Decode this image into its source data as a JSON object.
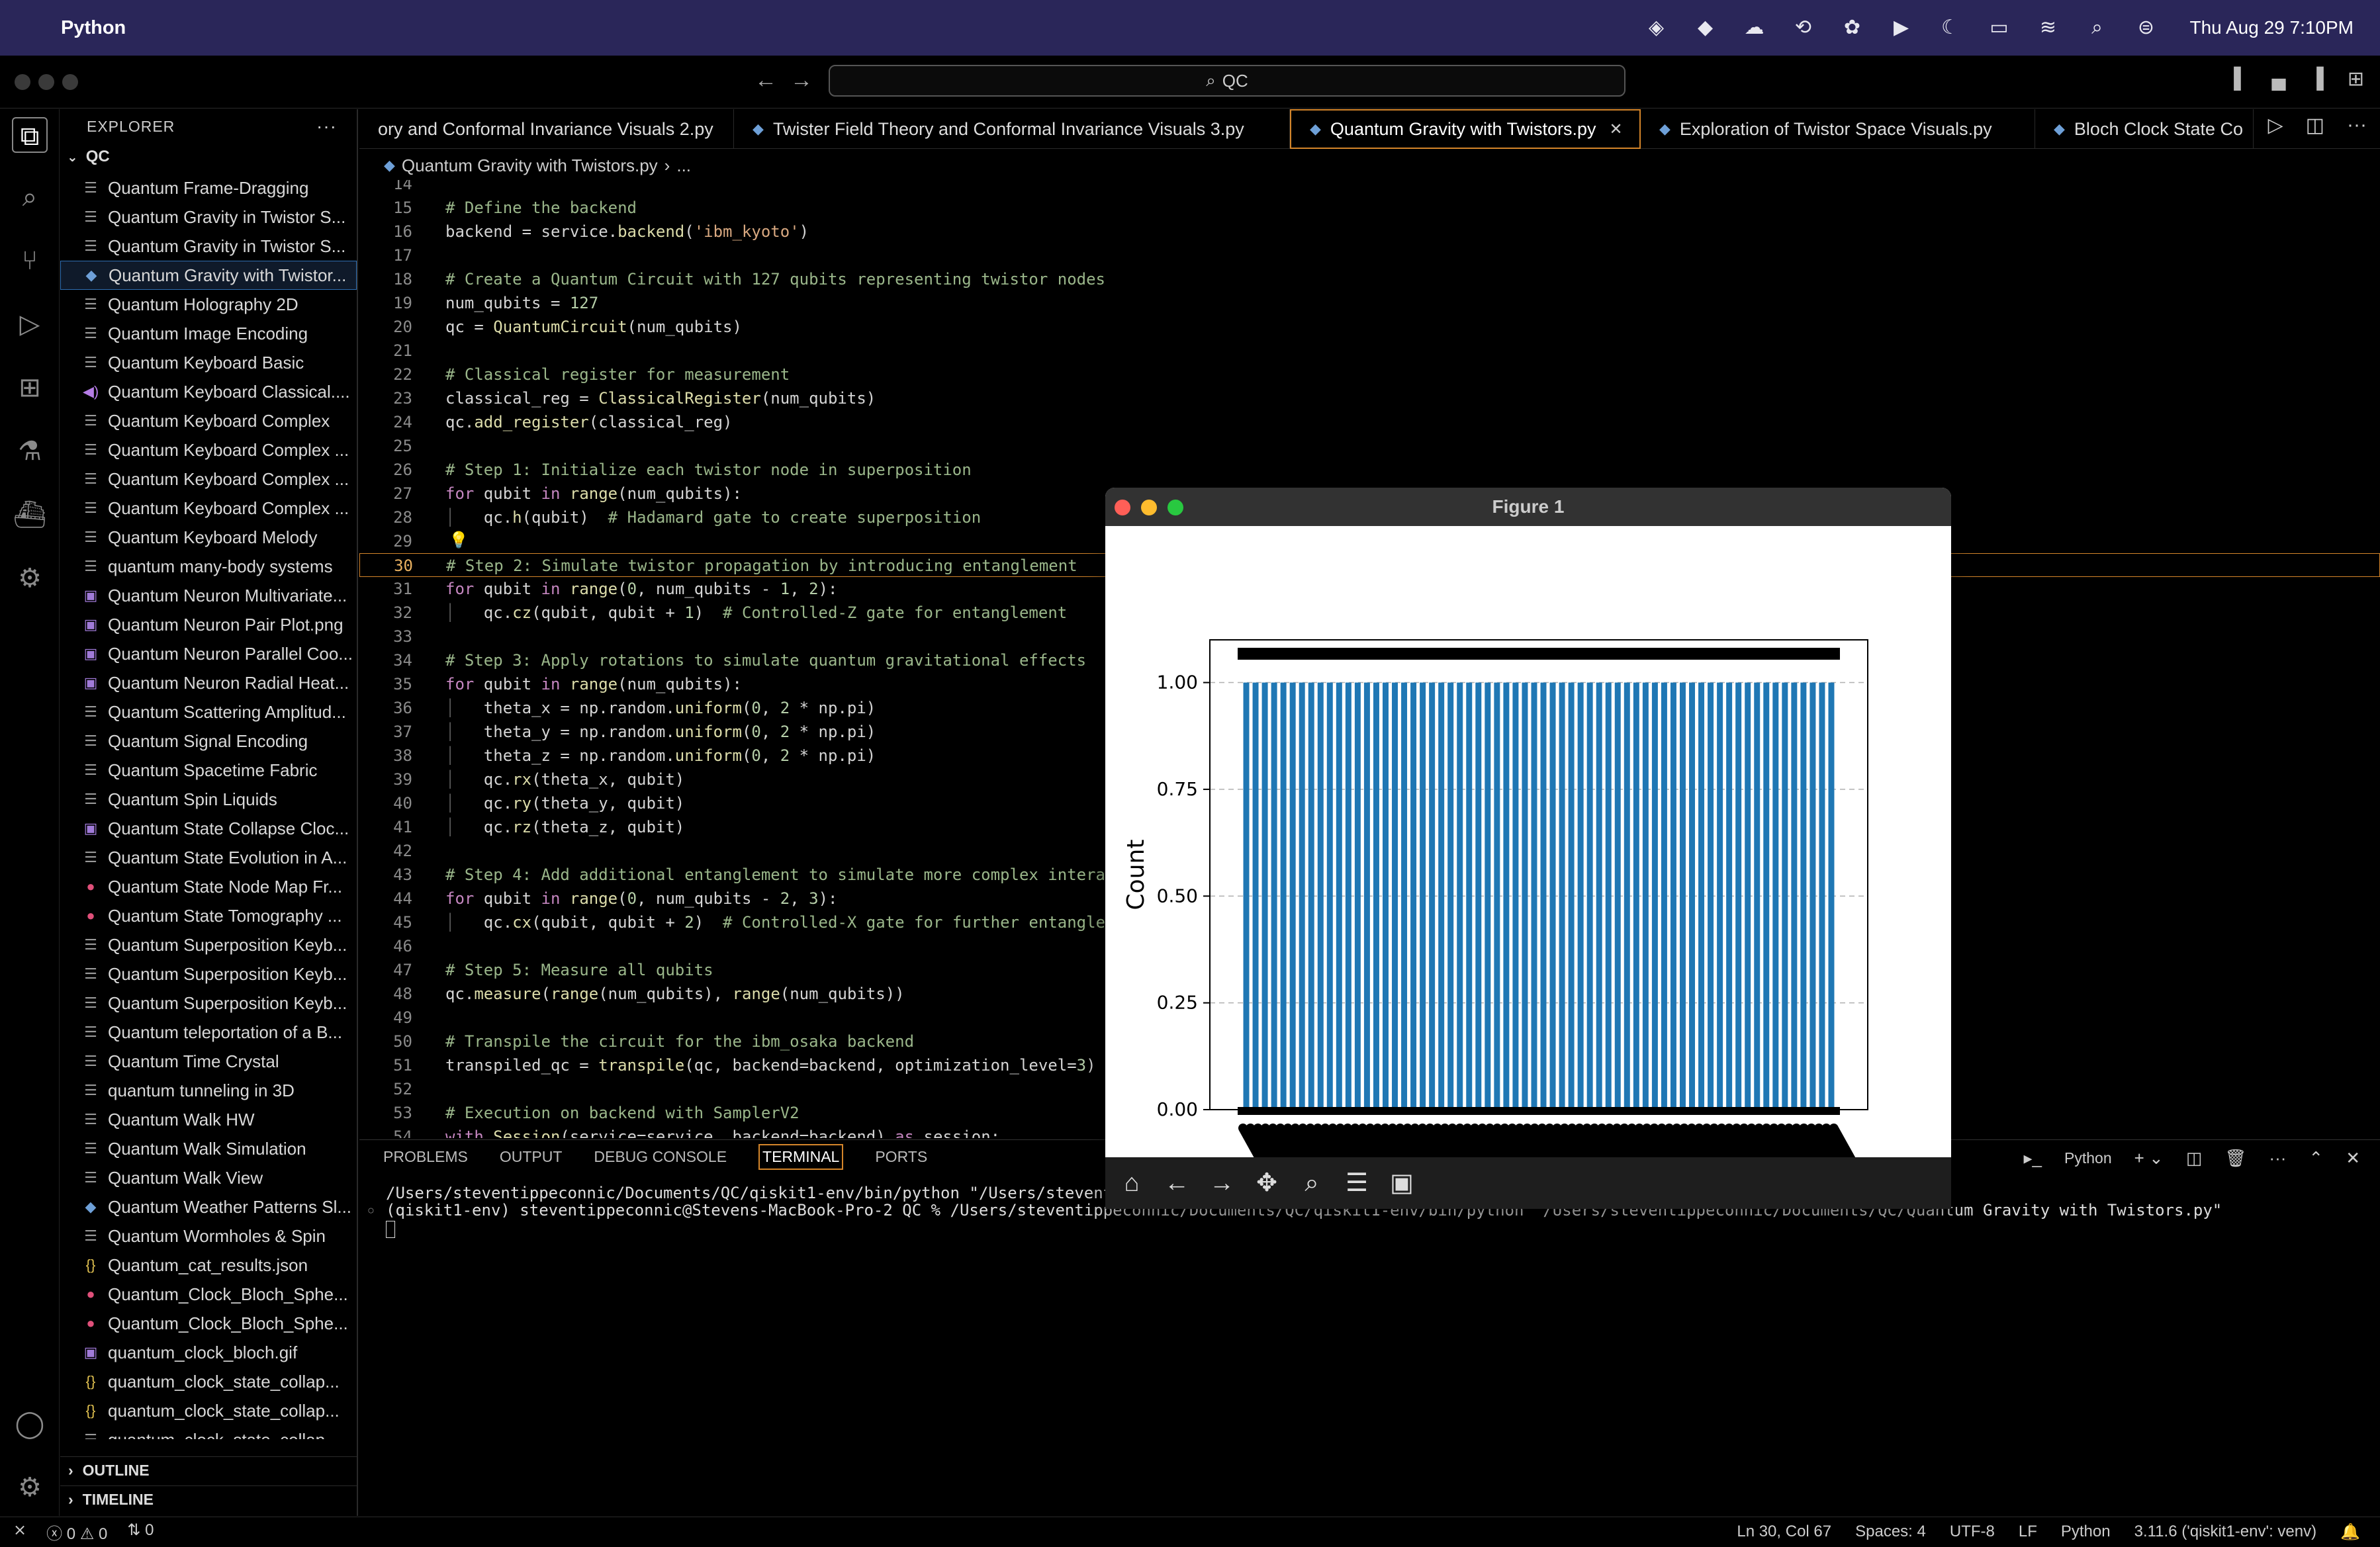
{
  "menubar": {
    "app_name": "Python",
    "clock": "Thu Aug 29  7:10PM",
    "icons": [
      "adguard-icon",
      "vpn-icon",
      "cloud-icon",
      "sync-icon",
      "chatgpt-icon",
      "play-icon",
      "moon-icon",
      "battery-icon",
      "wifi-icon",
      "search-icon",
      "control-center-icon"
    ]
  },
  "titlebar": {
    "search": "QC"
  },
  "sidebar": {
    "header": "EXPLORER",
    "folder": "QC",
    "files": [
      {
        "name": "Quantum Frame-Dragging",
        "type": "txt"
      },
      {
        "name": "Quantum Gravity in Twistor S...",
        "type": "txt"
      },
      {
        "name": "Quantum Gravity in Twistor S...",
        "type": "txt"
      },
      {
        "name": "Quantum Gravity with Twistor...",
        "type": "py",
        "selected": true
      },
      {
        "name": "Quantum Holography 2D",
        "type": "txt"
      },
      {
        "name": "Quantum Image Encoding",
        "type": "txt"
      },
      {
        "name": "Quantum Keyboard Basic",
        "type": "txt"
      },
      {
        "name": "Quantum Keyboard Classical....",
        "type": "audio"
      },
      {
        "name": "Quantum Keyboard Complex",
        "type": "txt"
      },
      {
        "name": "Quantum Keyboard Complex ...",
        "type": "txt"
      },
      {
        "name": "Quantum Keyboard Complex ...",
        "type": "txt"
      },
      {
        "name": "Quantum Keyboard Complex ...",
        "type": "txt"
      },
      {
        "name": "Quantum Keyboard Melody",
        "type": "txt"
      },
      {
        "name": "quantum many-body systems",
        "type": "txt"
      },
      {
        "name": "Quantum Neuron Multivariate...",
        "type": "img"
      },
      {
        "name": "Quantum Neuron Pair Plot.png",
        "type": "img"
      },
      {
        "name": "Quantum Neuron Parallel Coo...",
        "type": "img"
      },
      {
        "name": "Quantum Neuron Radial Heat...",
        "type": "img"
      },
      {
        "name": "Quantum Scattering Amplitud...",
        "type": "txt"
      },
      {
        "name": "Quantum Signal Encoding",
        "type": "txt"
      },
      {
        "name": "Quantum Spacetime Fabric",
        "type": "txt"
      },
      {
        "name": "Quantum Spin Liquids",
        "type": "txt"
      },
      {
        "name": "Quantum State Collapse Cloc...",
        "type": "img"
      },
      {
        "name": "Quantum State Evolution in A...",
        "type": "txt"
      },
      {
        "name": "Quantum State Node Map Fr...",
        "type": "red"
      },
      {
        "name": "Quantum State Tomography ...",
        "type": "red"
      },
      {
        "name": "Quantum Superposition Keyb...",
        "type": "txt"
      },
      {
        "name": "Quantum Superposition Keyb...",
        "type": "txt"
      },
      {
        "name": "Quantum Superposition Keyb...",
        "type": "txt"
      },
      {
        "name": "Quantum teleportation of a B...",
        "type": "txt"
      },
      {
        "name": "Quantum Time Crystal",
        "type": "txt"
      },
      {
        "name": "quantum tunneling in 3D",
        "type": "txt"
      },
      {
        "name": "Quantum Walk HW",
        "type": "txt"
      },
      {
        "name": "Quantum Walk Simulation",
        "type": "txt"
      },
      {
        "name": "Quantum Walk View",
        "type": "txt"
      },
      {
        "name": "Quantum Weather Patterns Sl...",
        "type": "py"
      },
      {
        "name": "Quantum Wormholes & Spin",
        "type": "txt"
      },
      {
        "name": "Quantum_cat_results.json",
        "type": "json"
      },
      {
        "name": "Quantum_Clock_Bloch_Sphe...",
        "type": "red"
      },
      {
        "name": "Quantum_Clock_Bloch_Sphe...",
        "type": "red"
      },
      {
        "name": "quantum_clock_bloch.gif",
        "type": "img"
      },
      {
        "name": "quantum_clock_state_collap...",
        "type": "json"
      },
      {
        "name": "quantum_clock_state_collap...",
        "type": "json"
      },
      {
        "name": "quantum_clock_state_collap...",
        "type": "txt"
      }
    ],
    "outline": "OUTLINE",
    "timeline": "TIMELINE"
  },
  "tabs": [
    {
      "label": "ory and Conformal Invariance Visuals 2.py",
      "active": false
    },
    {
      "label": "Twister Field Theory and Conformal Invariance Visuals 3.py",
      "active": false
    },
    {
      "label": "Quantum Gravity with Twistors.py",
      "active": true
    },
    {
      "label": "Exploration of Twistor Space Visuals.py",
      "active": false
    },
    {
      "label": "Bloch Clock State Co",
      "active": false
    }
  ],
  "breadcrumb": {
    "file": "Quantum Gravity with Twistors.py",
    "rest": "..."
  },
  "editor": {
    "current_line": 30,
    "lines": [
      {
        "n": 14,
        "code": ""
      },
      {
        "n": 15,
        "code": "# Define the backend"
      },
      {
        "n": 16,
        "code": "backend = service.backend('ibm_kyoto')"
      },
      {
        "n": 17,
        "code": ""
      },
      {
        "n": 18,
        "code": "# Create a Quantum Circuit with 127 qubits representing twistor nodes"
      },
      {
        "n": 19,
        "code": "num_qubits = 127"
      },
      {
        "n": 20,
        "code": "qc = QuantumCircuit(num_qubits)"
      },
      {
        "n": 21,
        "code": ""
      },
      {
        "n": 22,
        "code": "# Classical register for measurement"
      },
      {
        "n": 23,
        "code": "classical_reg = ClassicalRegister(num_qubits)"
      },
      {
        "n": 24,
        "code": "qc.add_register(classical_reg)"
      },
      {
        "n": 25,
        "code": ""
      },
      {
        "n": 26,
        "code": "# Step 1: Initialize each twistor node in superposition"
      },
      {
        "n": 27,
        "code": "for qubit in range(num_qubits):"
      },
      {
        "n": 28,
        "code": "    qc.h(qubit)  # Hadamard gate to create superposition"
      },
      {
        "n": 29,
        "code": ""
      },
      {
        "n": 30,
        "code": "# Step 2: Simulate twistor propagation by introducing entanglement"
      },
      {
        "n": 31,
        "code": "for qubit in range(0, num_qubits - 1, 2):"
      },
      {
        "n": 32,
        "code": "    qc.cz(qubit, qubit + 1)  # Controlled-Z gate for entanglement"
      },
      {
        "n": 33,
        "code": ""
      },
      {
        "n": 34,
        "code": "# Step 3: Apply rotations to simulate quantum gravitational effects"
      },
      {
        "n": 35,
        "code": "for qubit in range(num_qubits):"
      },
      {
        "n": 36,
        "code": "    theta_x = np.random.uniform(0, 2 * np.pi)"
      },
      {
        "n": 37,
        "code": "    theta_y = np.random.uniform(0, 2 * np.pi)"
      },
      {
        "n": 38,
        "code": "    theta_z = np.random.uniform(0, 2 * np.pi)"
      },
      {
        "n": 39,
        "code": "    qc.rx(theta_x, qubit)"
      },
      {
        "n": 40,
        "code": "    qc.ry(theta_y, qubit)"
      },
      {
        "n": 41,
        "code": "    qc.rz(theta_z, qubit)"
      },
      {
        "n": 42,
        "code": ""
      },
      {
        "n": 43,
        "code": "# Step 4: Add additional entanglement to simulate more complex intera"
      },
      {
        "n": 44,
        "code": "for qubit in range(0, num_qubits - 2, 3):"
      },
      {
        "n": 45,
        "code": "    qc.cx(qubit, qubit + 2)  # Controlled-X gate for further entangle"
      },
      {
        "n": 46,
        "code": ""
      },
      {
        "n": 47,
        "code": "# Step 5: Measure all qubits"
      },
      {
        "n": 48,
        "code": "qc.measure(range(num_qubits), range(num_qubits))"
      },
      {
        "n": 49,
        "code": ""
      },
      {
        "n": 50,
        "code": "# Transpile the circuit for the ibm_osaka backend"
      },
      {
        "n": 51,
        "code": "transpiled_qc = transpile(qc, backend=backend, optimization_level=3)"
      },
      {
        "n": 52,
        "code": ""
      },
      {
        "n": 53,
        "code": "# Execution on backend with SamplerV2"
      },
      {
        "n": 54,
        "code": "with Session(service=service, backend=backend) as session:"
      }
    ]
  },
  "panel": {
    "tabs": [
      "PROBLEMS",
      "OUTPUT",
      "DEBUG CONSOLE",
      "TERMINAL",
      "PORTS"
    ],
    "active_tab": "TERMINAL",
    "shell_label": "Python",
    "terminal_lines": [
      "/Users/steventippeconnic/Documents/QC/qiskit1-env/bin/python \"/Users/steventip",
      "(qiskit1-env) steventippeconnic@Stevens-MacBook-Pro-2 QC % /Users/steventippeconnic/Documents/QC/qiskit1-env/bin/python \"/Users/steventippeconnic/Documents/QC/Quantum Gravity with Twistors.py\""
    ]
  },
  "statusbar": {
    "errors": "0",
    "warnings": "0",
    "ports": "0",
    "position": "Ln 30, Col 67",
    "spaces": "Spaces: 4",
    "encoding": "UTF-8",
    "eol": "LF",
    "language": "Python",
    "interpreter": "3.11.6 ('qiskit1-env': venv)"
  },
  "figure": {
    "title": "Figure 1",
    "toolbar": [
      "home-icon",
      "back-arrow-icon",
      "forward-arrow-icon",
      "pan-icon",
      "zoom-icon",
      "configure-icon",
      "save-icon"
    ]
  },
  "chart_data": {
    "type": "bar",
    "ylabel": "Count",
    "xlabel": "",
    "ylim": [
      0,
      1.1
    ],
    "yticks": [
      "0.00",
      "0.25",
      "0.50",
      "0.75",
      "1.00"
    ],
    "grid": "y-dashed",
    "bar_color": "#1f77b4",
    "bar_count": 64,
    "value_per_bar": 1.0,
    "x_tick_labels": "overlapping, illegible"
  }
}
